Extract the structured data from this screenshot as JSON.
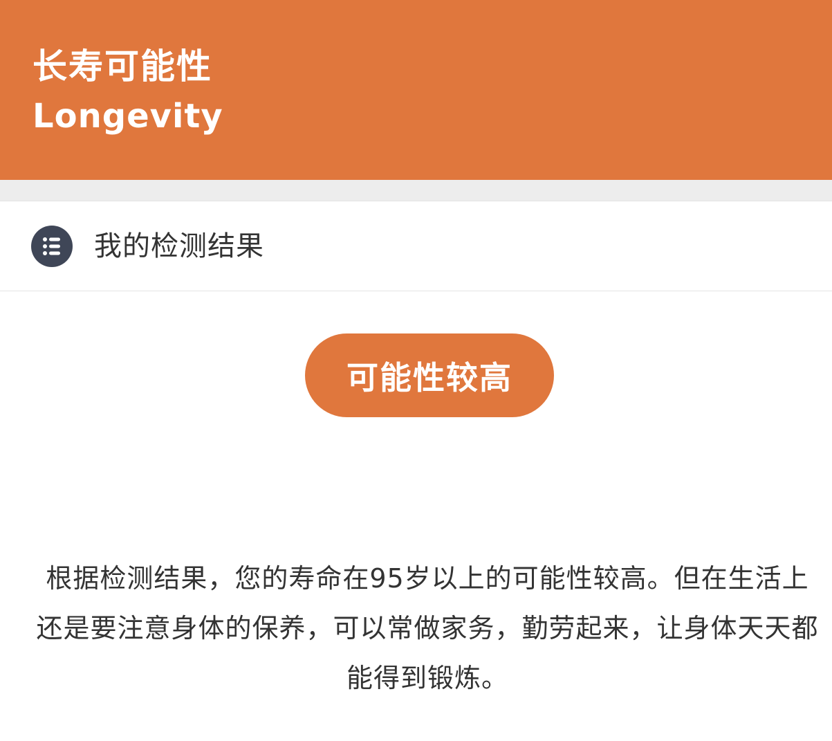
{
  "header": {
    "title": "长寿可能性",
    "subtitle": "Longevity",
    "background_color": "#e0773d"
  },
  "section": {
    "icon": "list-icon",
    "label": "我的检测结果"
  },
  "result": {
    "label": "可能性较高",
    "color": "#e0773d"
  },
  "description": {
    "text": "根据检测结果，您的寿命在95岁以上的可能性较高。但在生活上还是要注意身体的保养，可以常做家务，勤劳起来，让身体天天都能得到锻炼。"
  }
}
